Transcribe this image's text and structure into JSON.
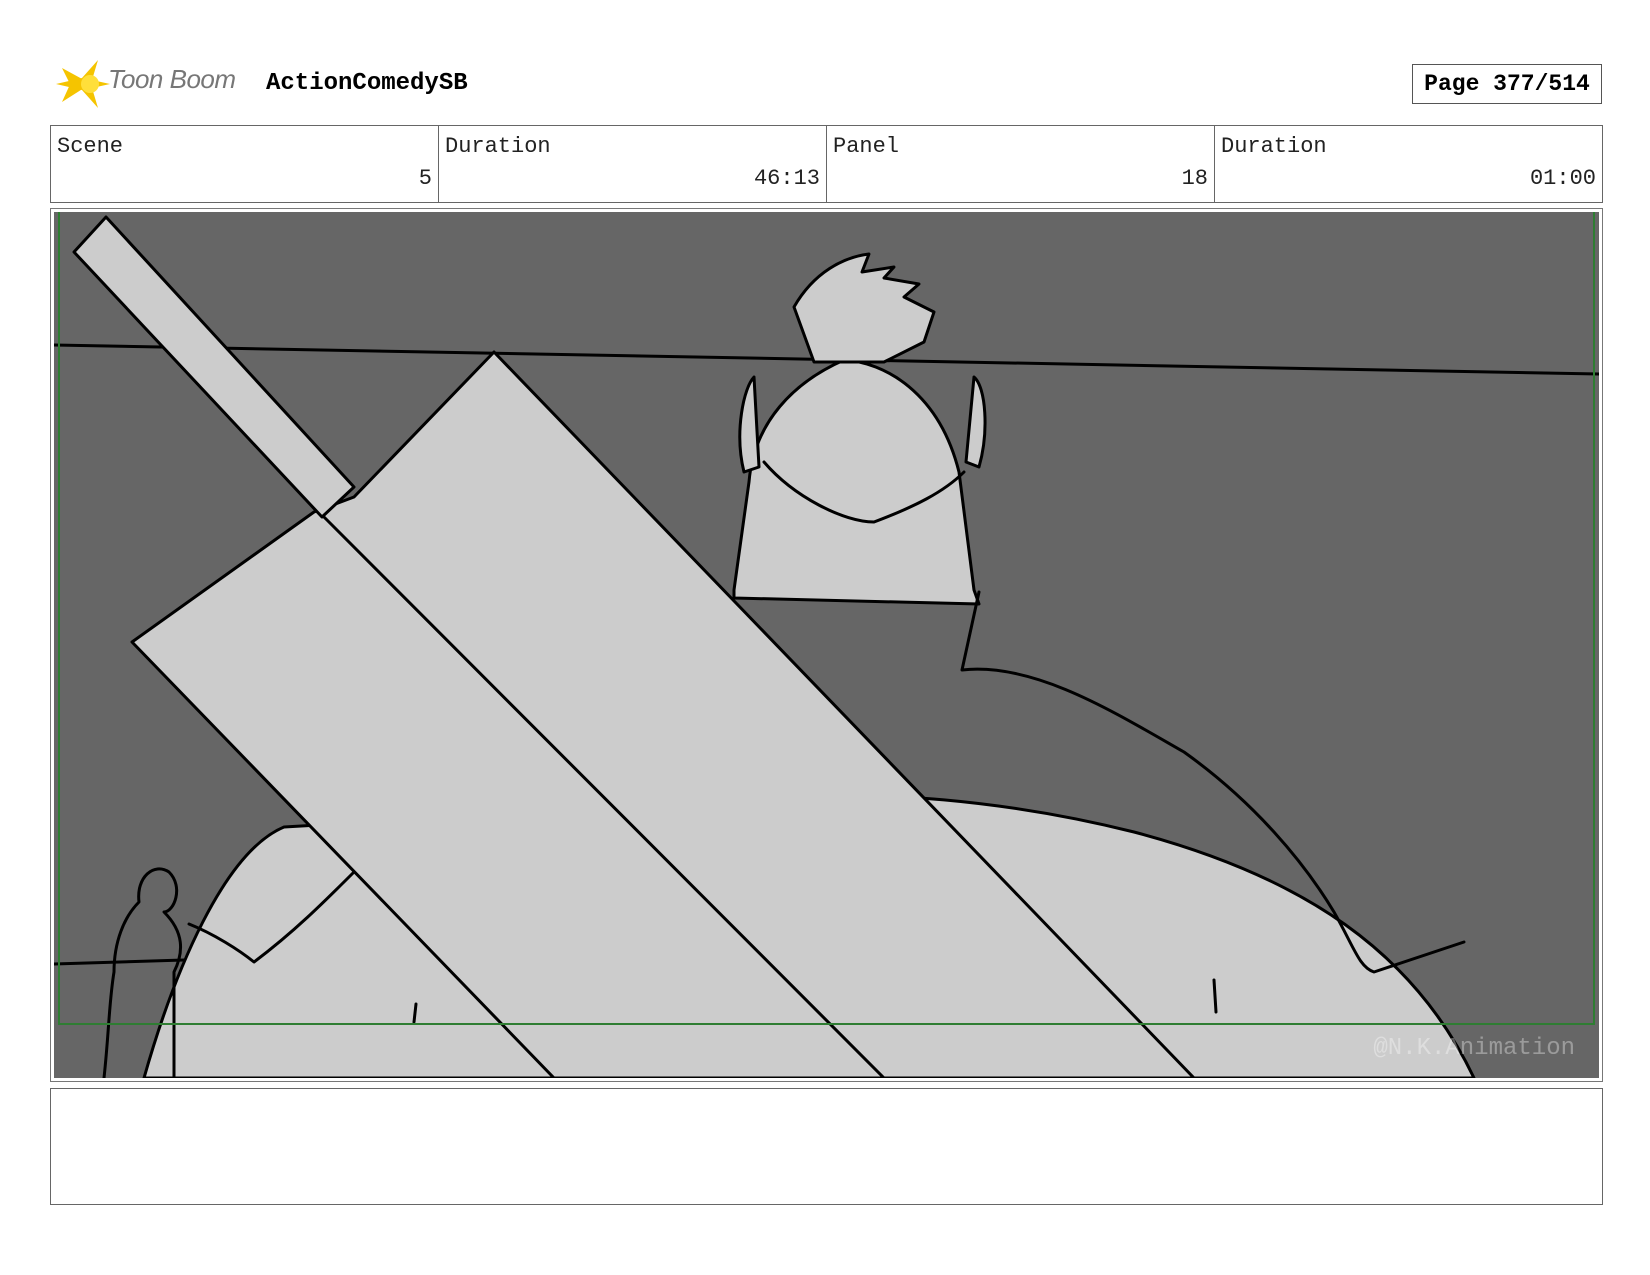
{
  "header": {
    "logo_text": "Toon Boom",
    "project_title": "ActionComedySB",
    "page_label": "Page 377/514"
  },
  "info": [
    {
      "label": "Scene",
      "value": "5"
    },
    {
      "label": "Duration",
      "value": "46:13"
    },
    {
      "label": "Panel",
      "value": "18"
    },
    {
      "label": "Duration",
      "value": "01:00"
    }
  ],
  "panel": {
    "watermark": "@N.K.Animation",
    "colors": {
      "background": "#666666",
      "fill": "#cccccc",
      "line": "#000000",
      "safe_frame": "#2e7d32"
    }
  },
  "notes": {
    "text": ""
  }
}
